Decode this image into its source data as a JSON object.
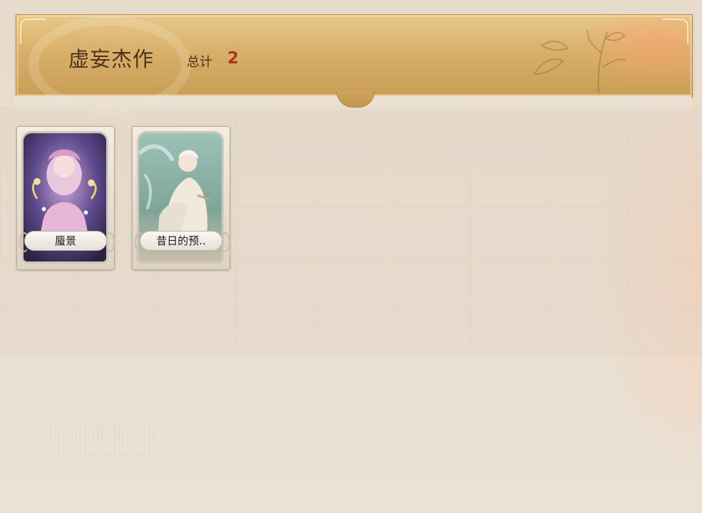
{
  "header": {
    "title": "虚妄杰作",
    "total_label": "总计",
    "total_value": "2"
  },
  "cards": [
    {
      "name": "蜃景",
      "art": "pink-jester-girl"
    },
    {
      "name": "昔日的预..",
      "art": "white-robed-seer"
    }
  ],
  "colors": {
    "banner_gold": "#d8b06a",
    "title_brown": "#4a321c",
    "total_red": "#b0341e",
    "parchment": "#e9dfd2"
  }
}
